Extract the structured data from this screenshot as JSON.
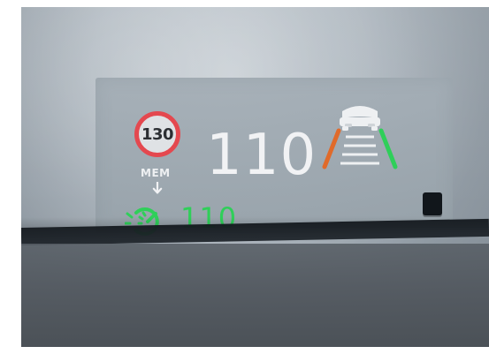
{
  "hud": {
    "speed_limit": "130",
    "mem_label": "MEM",
    "current_speed": "110",
    "cruise_speed": "110"
  },
  "icons": {
    "speed_limit": "speed-limit-sign-icon",
    "mem_arrow": "down-arrow-icon",
    "lane_assist": "lane-assist-icon",
    "cruise_control": "cruise-control-icon"
  },
  "colors": {
    "sign_red": "#e4484f",
    "text_white": "#f1f2f4",
    "green": "#2fcf59",
    "orange": "#e06a2a"
  }
}
